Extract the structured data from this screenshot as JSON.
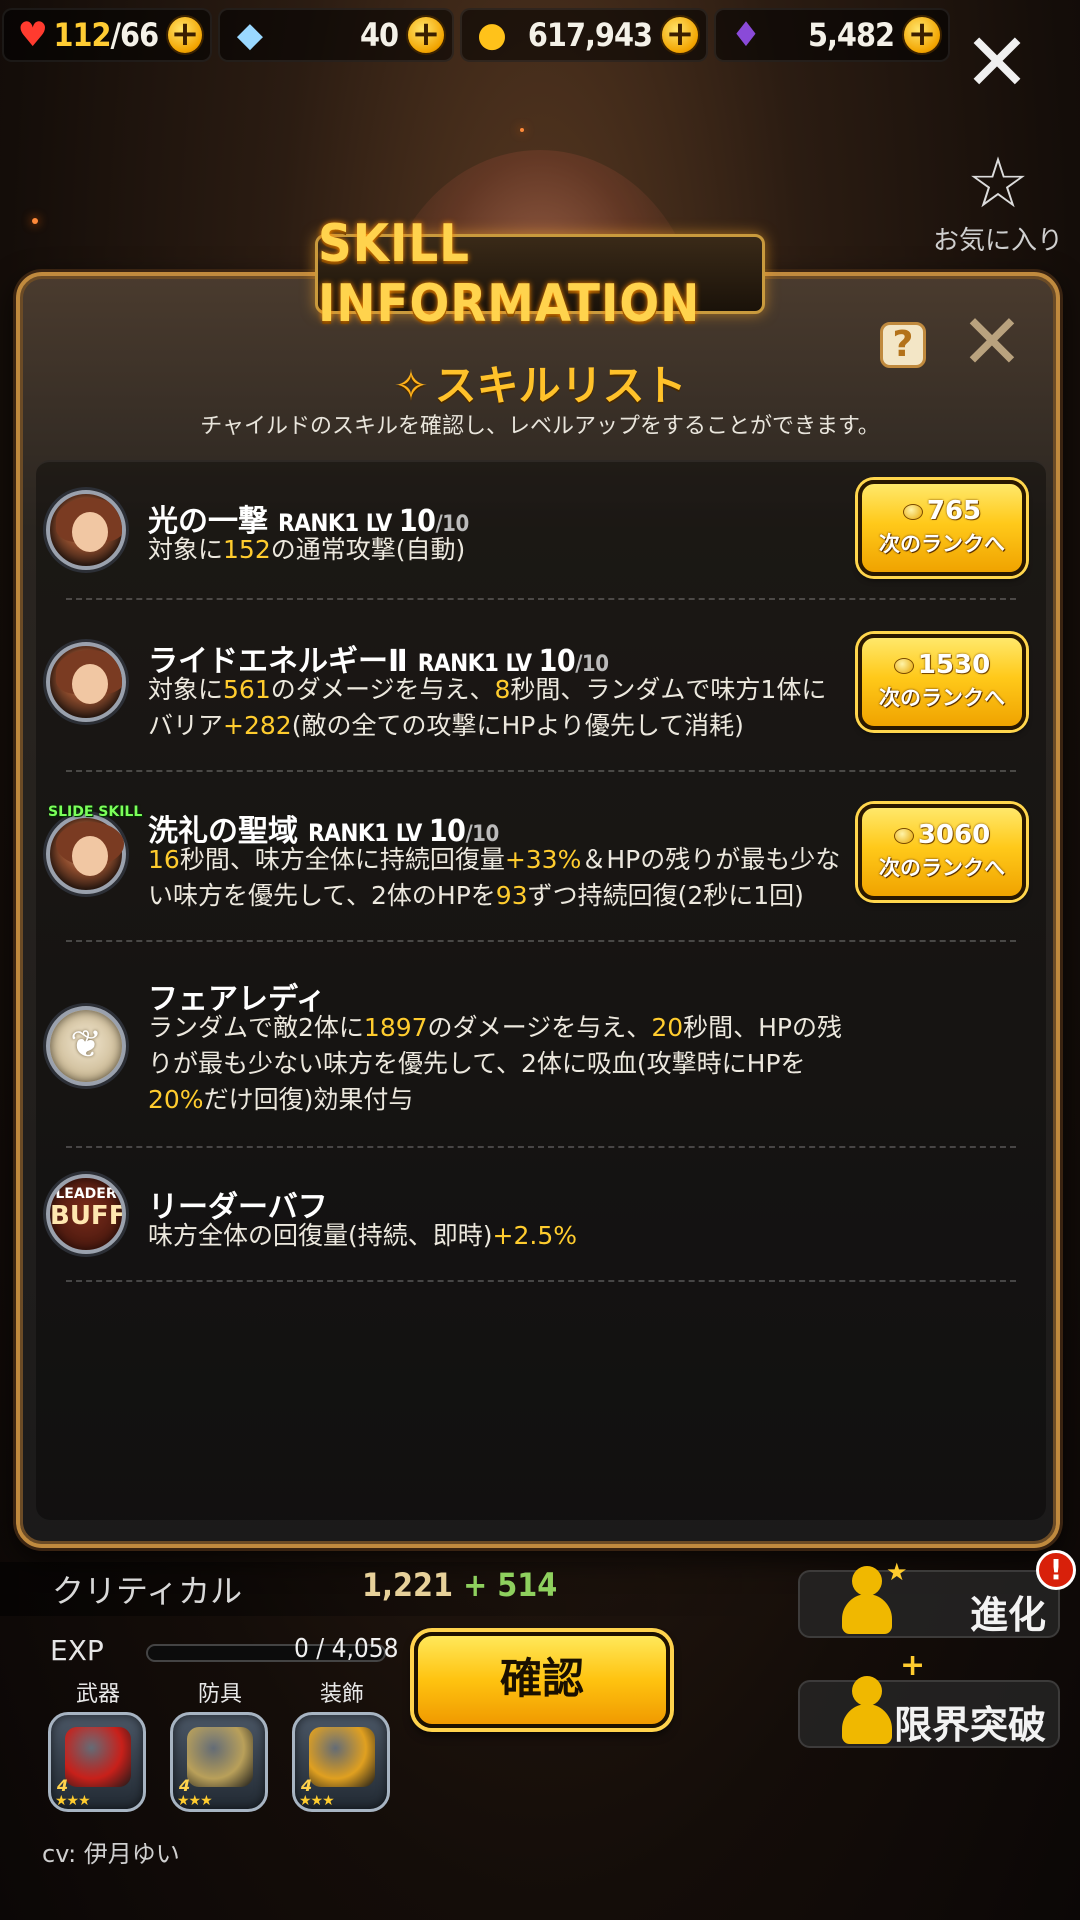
{
  "resources": [
    {
      "icon": "heart-icon",
      "value_current": "112",
      "value_max": "/66"
    },
    {
      "icon": "gem-icon",
      "value_current": "",
      "value_max": "40"
    },
    {
      "icon": "coin-icon",
      "value_current": "",
      "value_max": "617,943"
    },
    {
      "icon": "purple-gem-icon",
      "value_current": "",
      "value_max": "5,482"
    }
  ],
  "top": {
    "close_glyph": "✕",
    "favorite_label": "お気に入り"
  },
  "panel": {
    "title": "SKILL INFORMATION",
    "help": "?",
    "close_glyph": "✕",
    "header": "スキルリスト",
    "subtitle": "チャイルドのスキルを確認し、レベルアップをすることができます。"
  },
  "skills": [
    {
      "name": "光の一撃",
      "rank": "RANK1",
      "lv_prefix": "LV",
      "lv": "10",
      "lv_max": "/10",
      "desc_parts": [
        "対象に",
        "152",
        "の通常攻撃(自動)"
      ],
      "cost": "765",
      "button_label": "次のランクへ"
    },
    {
      "name": "ライドエネルギーⅡ",
      "rank": "RANK1",
      "lv_prefix": "LV",
      "lv": "10",
      "lv_max": "/10",
      "desc_parts": [
        "対象に",
        "561",
        "のダメージを与え、",
        "8",
        "秒間、ランダムで味方1体にバリア",
        "+282",
        "(敵の全ての攻撃にHPより優先して消耗)"
      ],
      "cost": "1530",
      "button_label": "次のランクへ"
    },
    {
      "name": "洗礼の聖域",
      "tag": "SLIDE SKILL",
      "rank": "RANK1",
      "lv_prefix": "LV",
      "lv": "10",
      "lv_max": "/10",
      "desc_parts": [
        "16",
        "秒間、味方全体に持続回復量",
        "+33%",
        "＆HPの残りが最も少ない味方を優先して、2体のHPを",
        "93",
        "ずつ持続回復(2秒に1回)"
      ],
      "cost": "3060",
      "button_label": "次のランクへ"
    },
    {
      "name": "フェアレディ",
      "desc_parts": [
        "ランダムで敵2体に",
        "1897",
        "のダメージを与え、",
        "20",
        "秒間、HPの残りが最も少ない味方を優先して、2体に吸血(攻撃時にHPを",
        "20%",
        "だけ回復)効果付与"
      ]
    },
    {
      "name": "リーダーバフ",
      "emblem_top": "LEADER",
      "emblem_bottom": "BUFF",
      "desc_parts": [
        "味方全体の回復量(持続、即時)",
        "+2.5%"
      ]
    }
  ],
  "stats": {
    "crit_label": "クリティカル",
    "crit_base": "1,221",
    "crit_bonus": "+ 514"
  },
  "exp": {
    "label": "EXP",
    "value": "0 / 4,058",
    "progress": 0
  },
  "confirm_label": "確認",
  "side_buttons": {
    "evolve": "進化",
    "limit_break": "限界突破",
    "alert": "!"
  },
  "equipment": [
    {
      "label": "武器",
      "level": "4",
      "stars": "★★★",
      "color": "#c8201a"
    },
    {
      "label": "防具",
      "level": "4",
      "stars": "★★★",
      "color": "#b9a05a"
    },
    {
      "label": "装飾",
      "level": "4",
      "stars": "★★★",
      "color": "#e0a020"
    }
  ],
  "cv": "cv: 伊月ゆい",
  "colors": {
    "accent": "#ffcc2e",
    "frame": "#c08a3e",
    "button_gold": "#ffc310"
  }
}
